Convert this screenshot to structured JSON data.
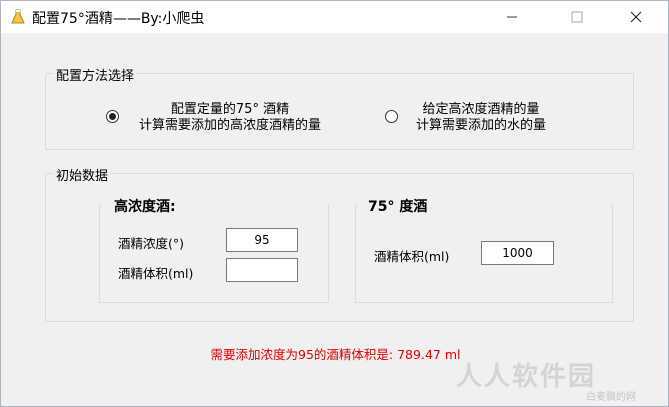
{
  "window": {
    "title": "配置75°酒精——By:小爬虫",
    "controls": {
      "minimize": "─",
      "maximize": "☐",
      "close": "✕"
    }
  },
  "method_group": {
    "legend": "配置方法选择",
    "options": [
      {
        "line1": "配置定量的75° 酒精",
        "line2": "计算需要添加的高浓度酒精的量",
        "checked": true
      },
      {
        "line1": "给定高浓度酒精的量",
        "line2": "计算需要添加的水的量",
        "checked": false
      }
    ]
  },
  "initial_group": {
    "legend": "初始数据",
    "high_alcohol": {
      "heading": "高浓度酒:",
      "concentration_label": "酒精浓度(°)",
      "concentration_value": "95",
      "volume_label": "酒精体积(ml)",
      "volume_value": ""
    },
    "target_alcohol": {
      "heading": "75° 度酒",
      "volume_label": "酒精体积(ml)",
      "volume_value": "1000"
    }
  },
  "result_text": "需要添加浓度为95的酒精体积是: 789.47 ml",
  "watermark": {
    "text": "人人软件园",
    "sub": "白麦飘的网"
  },
  "colors": {
    "result": "#e00000",
    "window_bg": "#f0f0f0"
  }
}
